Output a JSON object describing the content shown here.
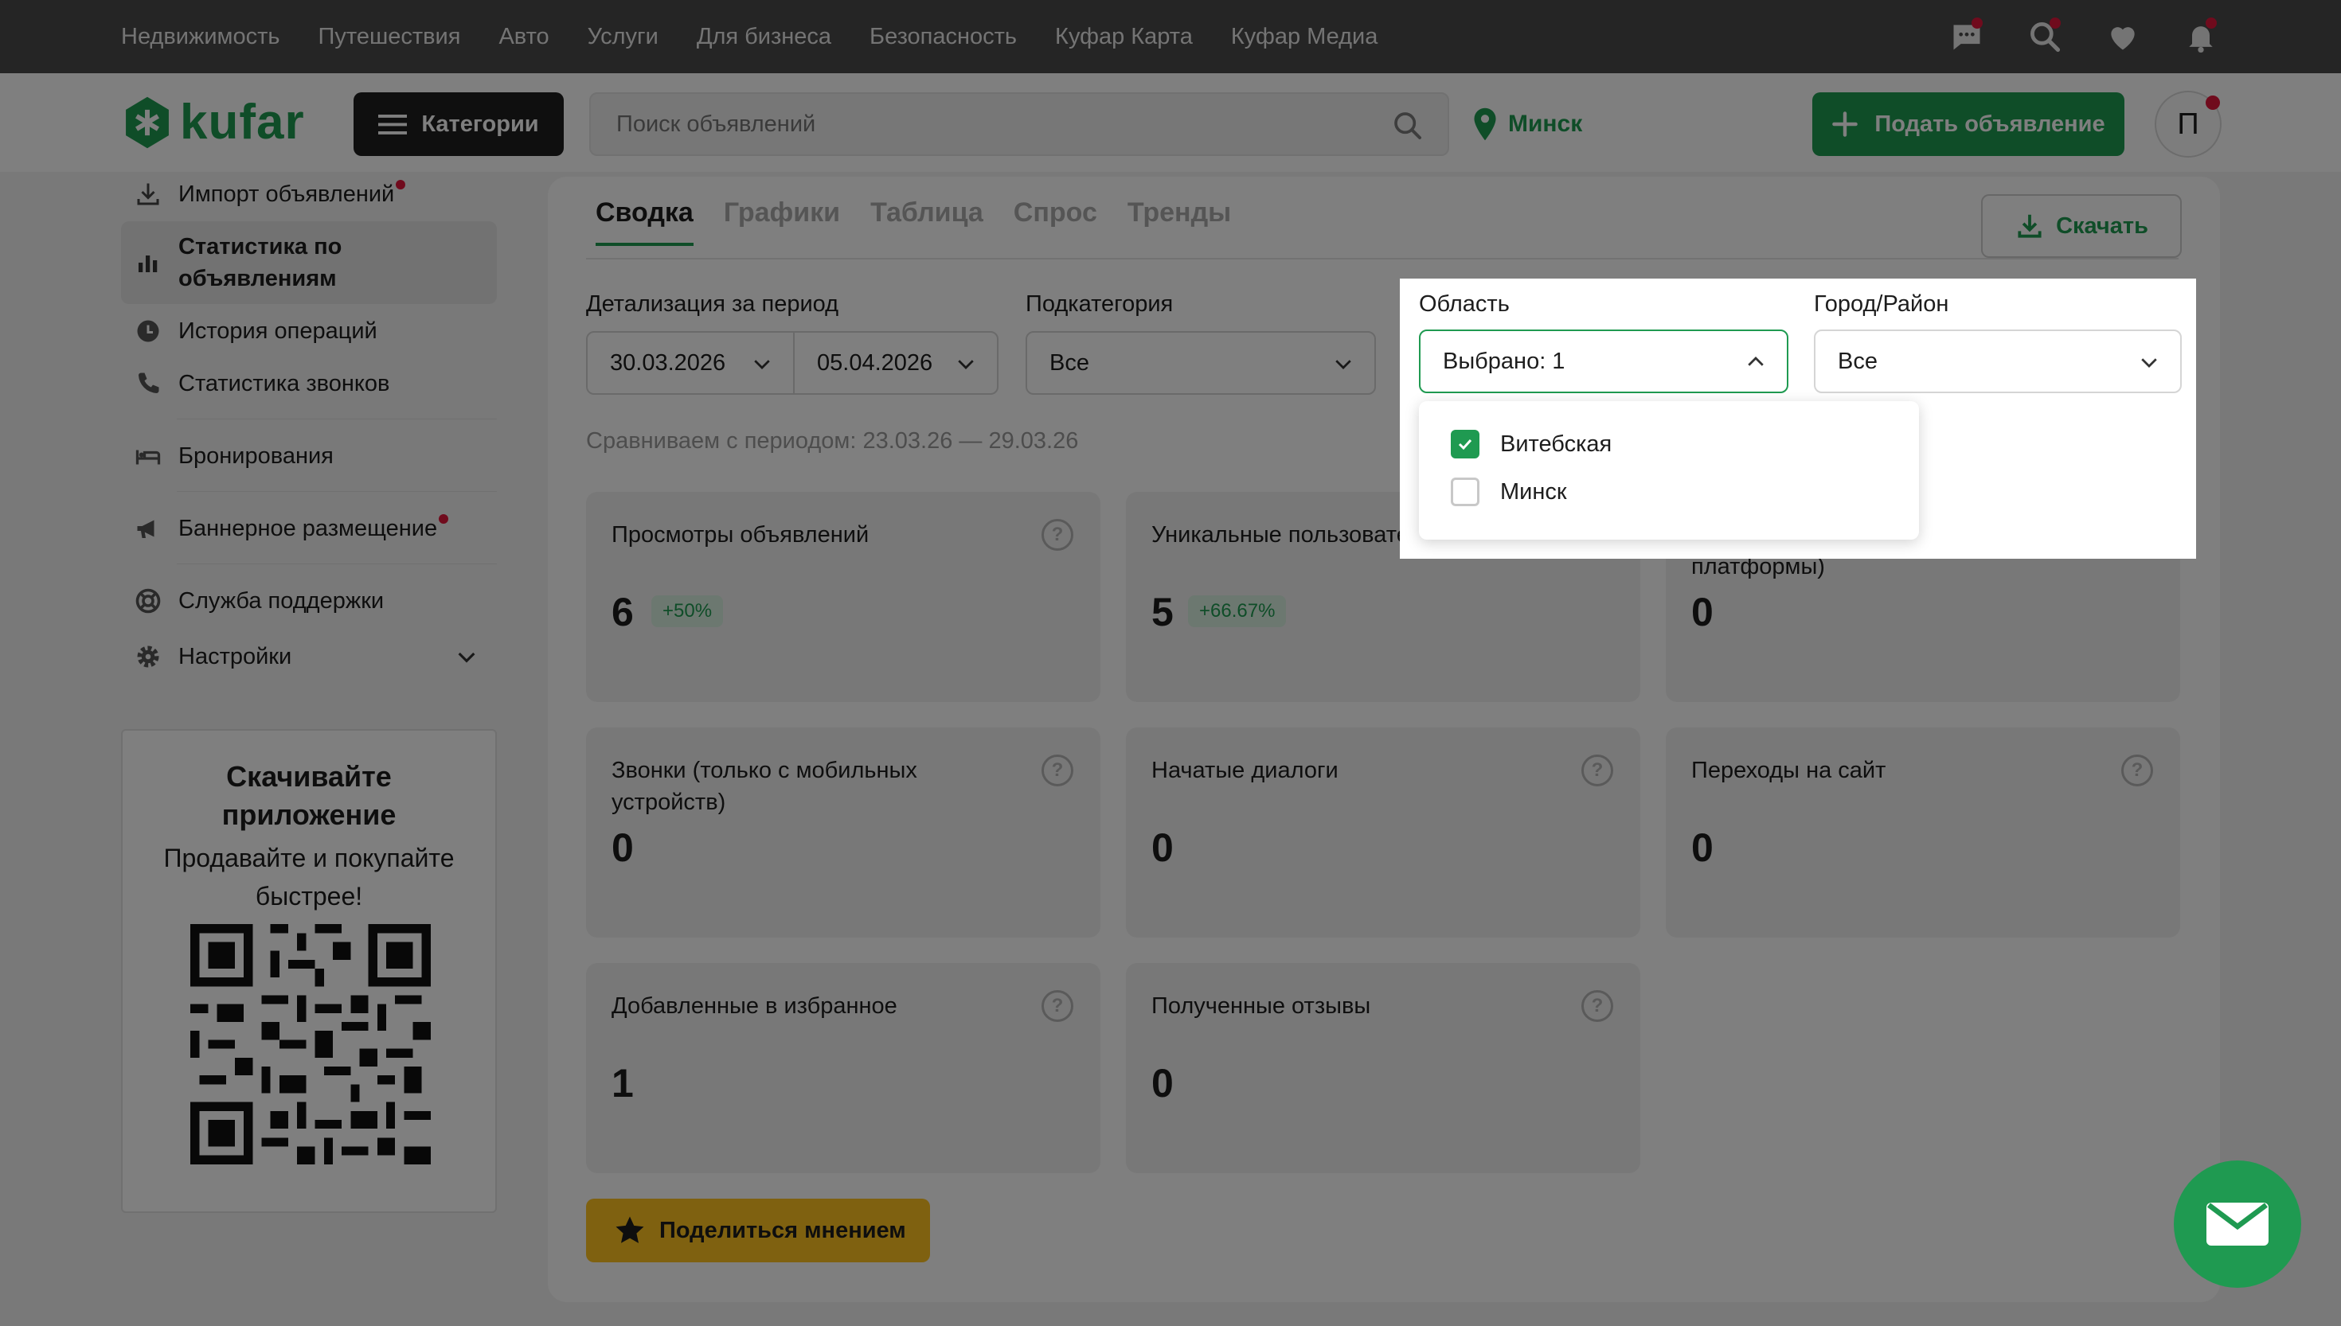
{
  "topnav": [
    "Недвижимость",
    "Путешествия",
    "Авто",
    "Услуги",
    "Для бизнеса",
    "Безопасность",
    "Куфар Карта",
    "Куфар Медиа"
  ],
  "header": {
    "logo": "kufar",
    "categories_label": "Категории",
    "search_placeholder": "Поиск объявлений",
    "city": "Минск",
    "post_label": "Подать объявление",
    "avatar_letter": "П"
  },
  "sidebar": {
    "items": [
      {
        "label": "Импорт объявлений",
        "icon": "download-icon"
      },
      {
        "label": "Статистика по объявлениям",
        "icon": "bar-chart-icon"
      },
      {
        "label": "История операций",
        "icon": "clock-icon"
      },
      {
        "label": "Статистика звонков",
        "icon": "phone-icon"
      },
      {
        "label": "Бронирования",
        "icon": "bed-icon"
      },
      {
        "label": "Баннерное размещение",
        "icon": "megaphone-icon"
      },
      {
        "label": "Служба поддержки",
        "icon": "lifebuoy-icon"
      },
      {
        "label": "Настройки",
        "icon": "gear-icon"
      }
    ],
    "app_title": "Скачивайте приложение",
    "app_text": "Продавайте и покупайте быстрее!"
  },
  "tabs": [
    "Сводка",
    "Графики",
    "Таблица",
    "Спрос",
    "Тренды"
  ],
  "download_label": "Скачать",
  "filters": {
    "period_label": "Детализация за период",
    "date_from": "30.03.2026",
    "date_to": "05.04.2026",
    "subcategory_label": "Подкатегория",
    "subcategory_value": "Все",
    "region_label": "Область",
    "region_value": "Выбрано: 1",
    "city_label": "Город/Район",
    "city_value": "Все",
    "region_options": [
      {
        "label": "Витебская",
        "checked": true
      },
      {
        "label": "Минск",
        "checked": false
      }
    ]
  },
  "compare_text": "Сравниваем с периодом: 23.03.26 — 29.03.26",
  "cards": [
    {
      "title": "Просмотры объявлений",
      "value": "6",
      "badge": "+50%"
    },
    {
      "title": "Уникальные пользователи",
      "value": "5",
      "badge": "+66.67%"
    },
    {
      "title": "Просмотры телефона (все платформы)",
      "value": "0",
      "badge": ""
    },
    {
      "title": "Звонки (только с мобильных устройств)",
      "value": "0",
      "badge": ""
    },
    {
      "title": "Начатые диалоги",
      "value": "0",
      "badge": ""
    },
    {
      "title": "Переходы на сайт",
      "value": "0",
      "badge": ""
    },
    {
      "title": "Добавленные в избранное",
      "value": "1",
      "badge": ""
    },
    {
      "title": "Полученные отзывы",
      "value": "0",
      "badge": ""
    }
  ],
  "share_label": "Поделиться мнением",
  "colors": {
    "brand": "#1f9a51",
    "accent_yellow": "#ffc220",
    "notification": "#e1173b"
  }
}
